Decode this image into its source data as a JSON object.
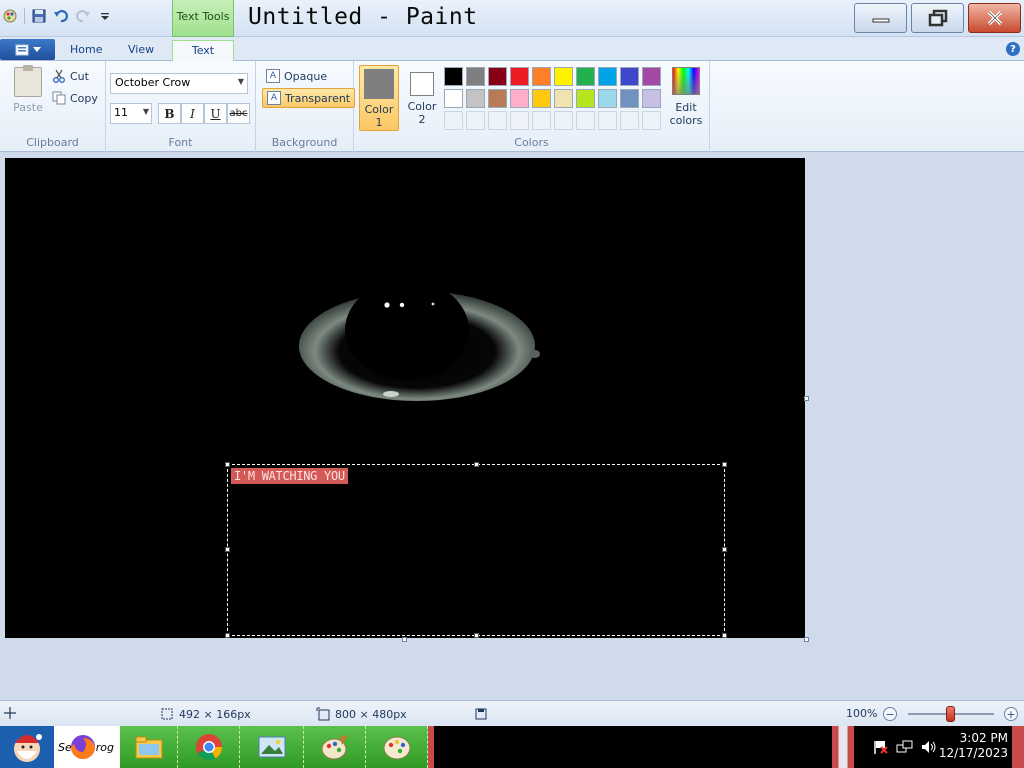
{
  "window": {
    "title": "Untitled - Paint",
    "contextual_tab_group": "Text Tools"
  },
  "tabs": [
    {
      "label": "Home"
    },
    {
      "label": "View"
    },
    {
      "label": "Text"
    }
  ],
  "ribbon": {
    "clipboard": {
      "group_label": "Clipboard",
      "paste_label": "Paste",
      "cut_label": "Cut",
      "copy_label": "Copy"
    },
    "font": {
      "group_label": "Font",
      "font_name": "October Crow",
      "font_size": "11",
      "bold": "B",
      "italic": "I",
      "underline": "U",
      "strikethrough": "abc"
    },
    "background": {
      "group_label": "Background",
      "opaque_label": "Opaque",
      "transparent_label": "Transparent",
      "selected": "Transparent"
    },
    "colors": {
      "group_label": "Colors",
      "color1_label": "Color 1",
      "color1_line1": "Color",
      "color1_line2": "1",
      "color2_line1": "Color",
      "color2_line2": "2",
      "color1_value": "#7f7f7f",
      "color2_value": "#ffffff",
      "edit_line1": "Edit",
      "edit_line2": "colors",
      "palette_row1": [
        "#000000",
        "#7f7f7f",
        "#880015",
        "#ed1c24",
        "#ff7f27",
        "#fff200",
        "#22b14c",
        "#00a2e8",
        "#3f48cc",
        "#a349a4"
      ],
      "palette_row2": [
        "#ffffff",
        "#c3c3c3",
        "#b97a57",
        "#ffaec9",
        "#ffc90e",
        "#efe4b0",
        "#b5e61d",
        "#99d9ea",
        "#7092be",
        "#c8bfe7"
      ]
    }
  },
  "canvas": {
    "text_content": "I'M WATCHING YOU",
    "text_bg_color": "#d45a58"
  },
  "statusbar": {
    "selection_size": "492 × 166px",
    "image_size": "800 × 480px",
    "zoom": "100%",
    "zoom_percent": 100
  },
  "taskbar": {
    "time": "3:02 PM",
    "date": "12/17/2023",
    "firefox_partial_label": "Se",
    "firefox_partial_label2": "rog"
  }
}
